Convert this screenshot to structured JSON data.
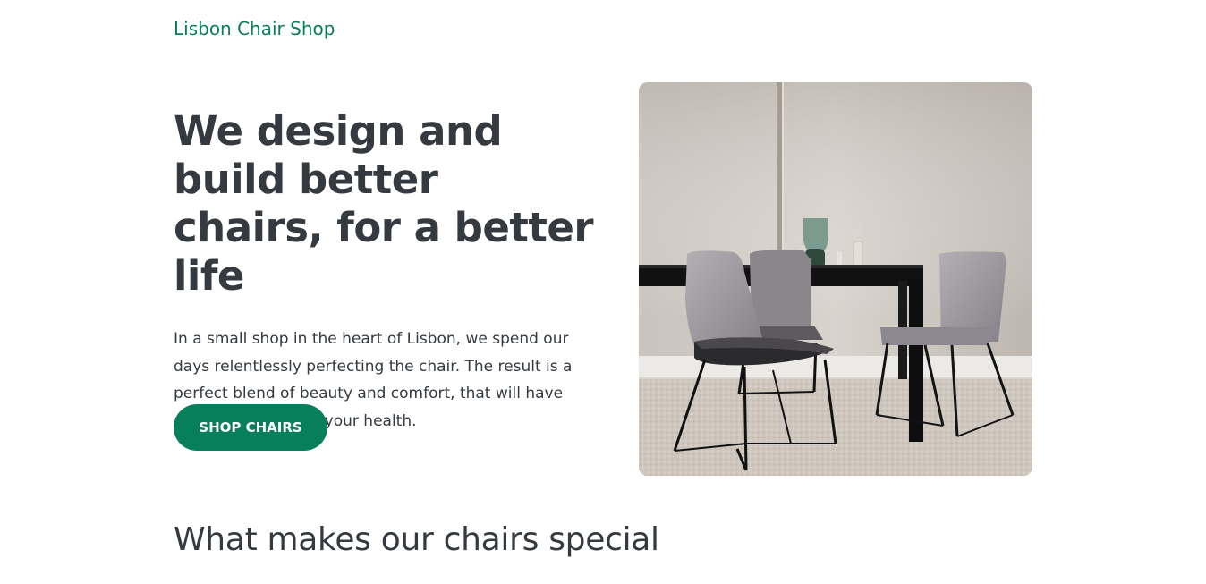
{
  "header": {
    "brand": "Lisbon Chair Shop"
  },
  "hero": {
    "title": "We design and build better chairs, for a better life",
    "description": "In a small shop in the heart of Lisbon, we spend our days relentlessly perfecting the chair. The result is a perfect blend of beauty and comfort, that will have a lasting impact on your health.",
    "cta_label": "SHOP CHAIRS"
  },
  "features": {
    "heading": "What makes our chairs special"
  },
  "colors": {
    "accent": "#087f5b",
    "text": "#343a40",
    "background": "#ffffff"
  }
}
